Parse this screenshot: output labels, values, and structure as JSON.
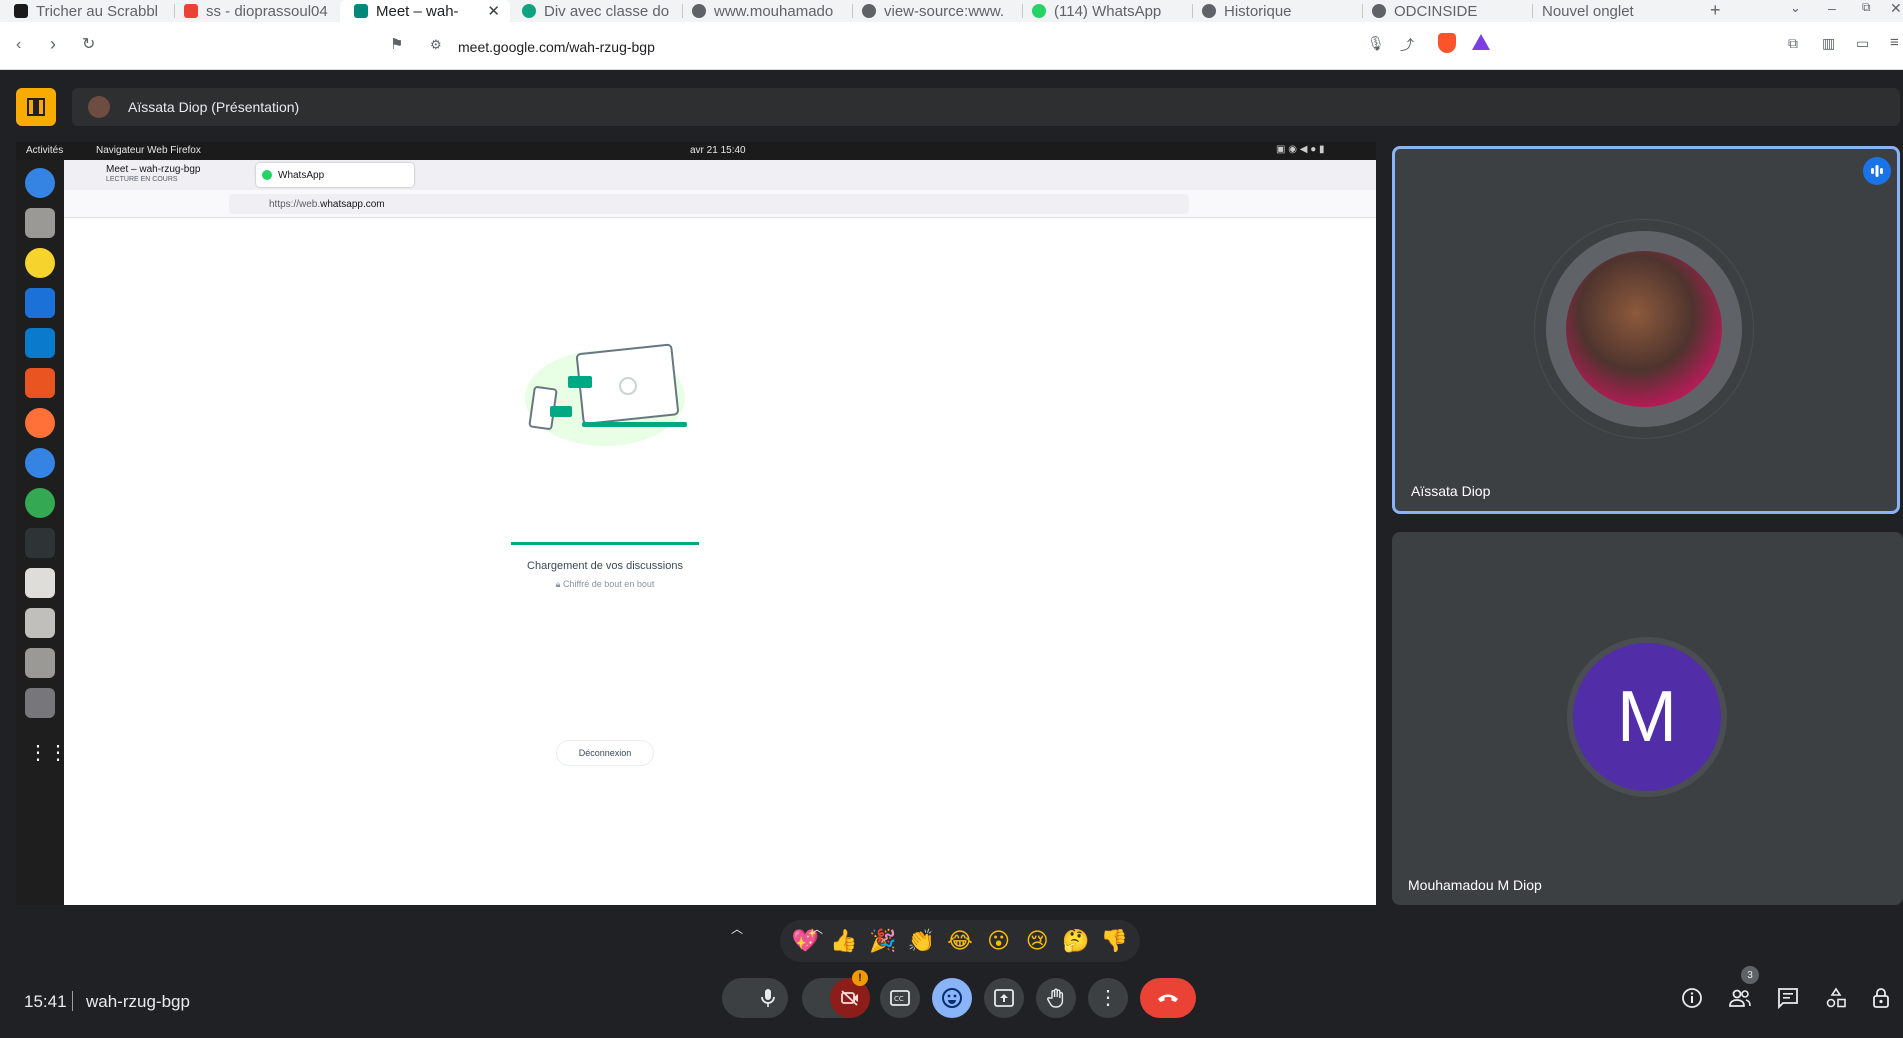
{
  "browser": {
    "tabs": [
      {
        "label": "Tricher au Scrabbl",
        "color": "#1a73e8"
      },
      {
        "label": "ss - dioprassoul04",
        "color": "#ea4335"
      },
      {
        "label": "Meet – wah-",
        "color": "#00897b"
      },
      {
        "label": "Div avec classe do",
        "color": "#10a37f"
      },
      {
        "label": "www.mouhamado",
        "color": "#5f6368"
      },
      {
        "label": "view-source:www.",
        "color": "#5f6368"
      },
      {
        "label": "(114) WhatsApp",
        "color": "#25d366"
      },
      {
        "label": "Historique",
        "color": "#5f6368"
      },
      {
        "label": "ODCINSIDE",
        "color": "#5f6368"
      },
      {
        "label": "Nouvel onglet",
        "color": ""
      }
    ],
    "url": "meet.google.com/wah-rzug-bgp"
  },
  "meet": {
    "presenter_label": "Aïssata Diop (Présentation)",
    "participants": [
      {
        "name": "Aïssata Diop",
        "initial": ""
      },
      {
        "name": "Mouhamadou M Diop",
        "initial": "M"
      }
    ],
    "participant_count": "3",
    "clock": "15:41",
    "meeting_code": "wah-rzug-bgp",
    "reactions": [
      "💖",
      "👍",
      "🎉",
      "👏",
      "😂",
      "😮",
      "😢",
      "🤔",
      "👎"
    ],
    "colors": {
      "accent": "#8ab4f8",
      "hangup": "#ea4335",
      "avatar_m": "#512da8",
      "active_border": "#8ab4f8"
    }
  },
  "shared_screen": {
    "topbar": {
      "activities": "Activités",
      "app": "Navigateur Web Firefox",
      "datetime": "avr 21  15:40"
    },
    "firefox": {
      "tabs": [
        {
          "label": "Meet – wah-rzug-bgp",
          "sub": "LECTURE EN COURS"
        },
        {
          "label": "WhatsApp",
          "sub": ""
        }
      ],
      "url_prefix": "https://web.",
      "url_domain": "whatsapp.com"
    },
    "whatsapp": {
      "loading": "Chargement de vos discussions",
      "encrypted": "Chiffré de bout en bout",
      "logout": "Déconnexion"
    }
  }
}
